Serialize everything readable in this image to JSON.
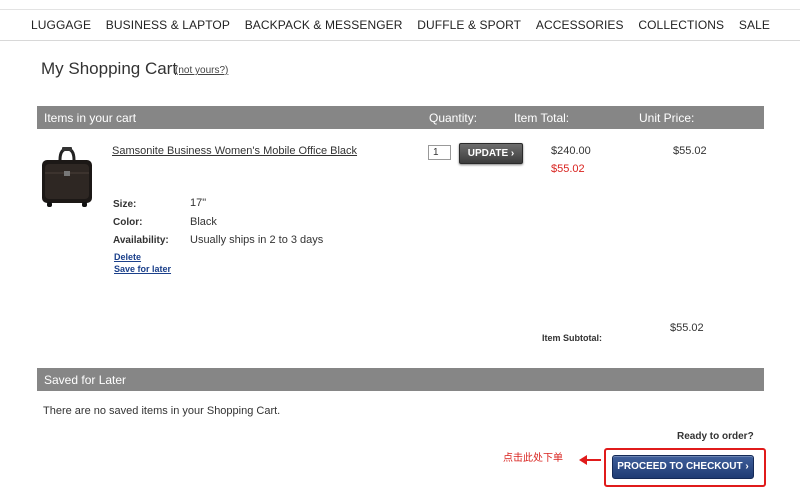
{
  "nav": [
    "LUGGAGE",
    "BUSINESS & LAPTOP",
    "BACKPACK & MESSENGER",
    "DUFFLE & SPORT",
    "ACCESSORIES",
    "COLLECTIONS",
    "SALE"
  ],
  "page": {
    "title": "My Shopping Cart",
    "not_yours": "(not yours?)"
  },
  "cart_header": {
    "title": "Items in your cart",
    "quantity": "Quantity:",
    "item_total": "Item Total:",
    "unit_price": "Unit Price:"
  },
  "item": {
    "name": "Samsonite Business Women's Mobile Office Black",
    "quantity": "1",
    "update_label": "UPDATE",
    "update_icon": "chevron-right-icon",
    "list_total": "$240.00",
    "sale_total": "$55.02",
    "unit_price": "$55.02",
    "attributes": [
      {
        "label": "Size:",
        "value": "17\""
      },
      {
        "label": "Color:",
        "value": "Black"
      },
      {
        "label": "Availability:",
        "value": "Usually ships in 2 to 3 days"
      }
    ],
    "delete_label": "Delete",
    "save_later_label": "Save for later",
    "thumbnail_icon": "briefcase-icon"
  },
  "subtotal": {
    "label": "Item Subtotal:",
    "value": "$55.02"
  },
  "saved": {
    "title": "Saved for Later",
    "empty": "There are no saved items in your Shopping Cart."
  },
  "checkout": {
    "ready": "Ready to order?",
    "annotation": "点击此处下单",
    "button": "PROCEED TO CHECKOUT",
    "button_icon": "chevron-right-icon"
  },
  "colors": {
    "header_bar": "#868686",
    "price_red": "#d9231f",
    "checkout_blue": "#1f3b73",
    "highlight_red": "#e01b1b"
  }
}
